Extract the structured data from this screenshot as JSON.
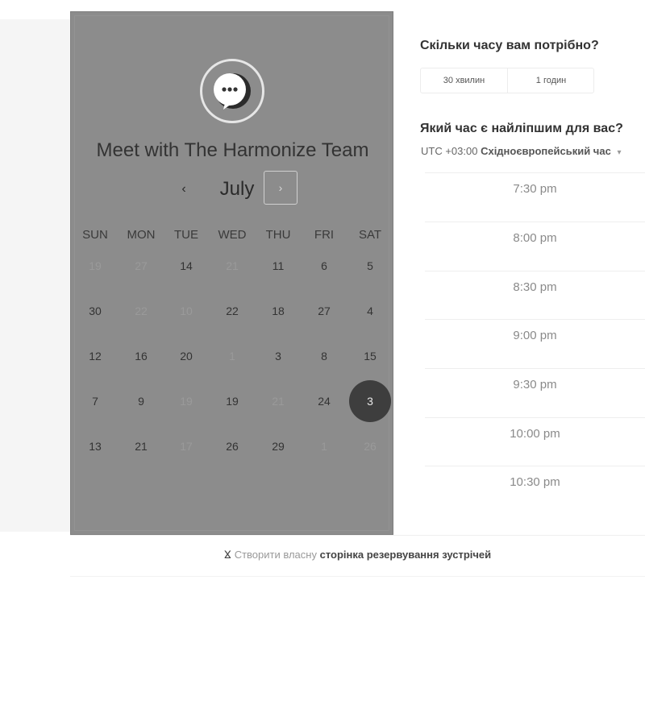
{
  "header": {
    "title": "Meet with The Harmonize Team",
    "month": "July",
    "prev_glyph": "‹",
    "next_glyph": "›"
  },
  "calendar": {
    "weekdays": [
      "SUN",
      "MON",
      "TUE",
      "WED",
      "THU",
      "FRI",
      "SAT"
    ],
    "weeks": [
      [
        {
          "d": "19",
          "m": true
        },
        {
          "d": "27",
          "m": true
        },
        {
          "d": "14",
          "m": false
        },
        {
          "d": "21",
          "m": true
        },
        {
          "d": "11",
          "m": false
        },
        {
          "d": "6",
          "m": false
        },
        {
          "d": "5",
          "m": false
        }
      ],
      [
        {
          "d": "30",
          "m": false
        },
        {
          "d": "22",
          "m": true
        },
        {
          "d": "10",
          "m": true
        },
        {
          "d": "22",
          "m": false
        },
        {
          "d": "18",
          "m": false
        },
        {
          "d": "27",
          "m": false
        },
        {
          "d": "4",
          "m": false
        }
      ],
      [
        {
          "d": "12",
          "m": false
        },
        {
          "d": "16",
          "m": false
        },
        {
          "d": "20",
          "m": false
        },
        {
          "d": "1",
          "m": true
        },
        {
          "d": "3",
          "m": false
        },
        {
          "d": "8",
          "m": false
        },
        {
          "d": "15",
          "m": false
        }
      ],
      [
        {
          "d": "7",
          "m": false
        },
        {
          "d": "9",
          "m": false
        },
        {
          "d": "19",
          "m": true
        },
        {
          "d": "19",
          "m": false
        },
        {
          "d": "21",
          "m": true
        },
        {
          "d": "24",
          "m": false
        },
        {
          "d": "3",
          "m": false,
          "sel": true
        }
      ],
      [
        {
          "d": "13",
          "m": false
        },
        {
          "d": "21",
          "m": false
        },
        {
          "d": "17",
          "m": true
        },
        {
          "d": "26",
          "m": false
        },
        {
          "d": "29",
          "m": false
        },
        {
          "d": "1",
          "m": true
        },
        {
          "d": "26",
          "m": true
        }
      ]
    ]
  },
  "duration": {
    "question": "Скільки часу вам потрібно?",
    "options": [
      "30 хвилин",
      "1 годин"
    ]
  },
  "timezone": {
    "question": "Який час є найліпшим для вас?",
    "offset": "UTC +03:00",
    "name": "Східноєвропейський час",
    "caret": "▾"
  },
  "slots": [
    "7:30 pm",
    "8:00 pm",
    "8:30 pm",
    "9:00 pm",
    "9:30 pm",
    "10:00 pm",
    "10:30 pm"
  ],
  "footer": {
    "prefix": "Створити власну",
    "link": "сторінка резервування зустрічей",
    "icon": "hubspot-sprocket-icon",
    "icon_glyph": "ⴴ"
  },
  "colors": {
    "panel_bg": "#8c8c8c",
    "selected_day_bg": "#3e3e3e"
  }
}
